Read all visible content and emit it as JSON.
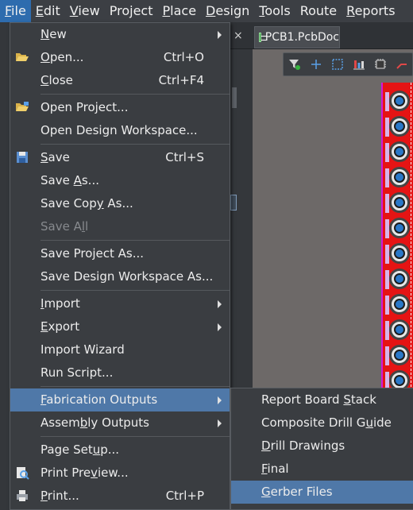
{
  "menubar": [
    {
      "label": "File",
      "ul": "F",
      "rest": "ile"
    },
    {
      "label": "Edit",
      "ul": "E",
      "rest": "dit"
    },
    {
      "label": "View",
      "ul": "V",
      "rest": "iew"
    },
    {
      "label": "Project",
      "ul": "",
      "rest": "Project"
    },
    {
      "label": "Place",
      "ul": "P",
      "rest": "lace"
    },
    {
      "label": "Design",
      "ul": "D",
      "rest": "esign"
    },
    {
      "label": "Tools",
      "ul": "T",
      "rest": "ools"
    },
    {
      "label": "Route",
      "ul": "",
      "rest": "Route"
    },
    {
      "label": "Reports",
      "ul": "R",
      "rest": "eports"
    }
  ],
  "document_tab": {
    "title": "PCB1.PcbDoc",
    "close": "×"
  },
  "file_menu": {
    "items": [
      {
        "pre": "",
        "ul": "N",
        "post": "ew",
        "shortcut": "",
        "submenu": true
      },
      {
        "pre": "",
        "ul": "O",
        "post": "pen...",
        "shortcut": "Ctrl+O",
        "icon": "folder-open-icon"
      },
      {
        "pre": "",
        "ul": "C",
        "post": "lose",
        "shortcut": "Ctrl+F4"
      },
      {
        "pre": "Open Project...",
        "ul": "",
        "post": "",
        "shortcut": "",
        "icon": "folder-project-icon"
      },
      {
        "pre": "Open Design Workspace...",
        "ul": "",
        "post": "",
        "shortcut": ""
      },
      {
        "pre": "",
        "ul": "S",
        "post": "ave",
        "shortcut": "Ctrl+S",
        "icon": "save-icon"
      },
      {
        "pre": "Save ",
        "ul": "A",
        "post": "s...",
        "shortcut": ""
      },
      {
        "pre": "Save Cop",
        "ul": "y",
        "post": " As...",
        "shortcut": ""
      },
      {
        "pre": "Save A",
        "ul": "l",
        "post": "l",
        "shortcut": "",
        "disabled": true
      },
      {
        "pre": "Save Project As...",
        "ul": "",
        "post": "",
        "shortcut": ""
      },
      {
        "pre": "Save Design Workspace As...",
        "ul": "",
        "post": "",
        "shortcut": ""
      },
      {
        "pre": "",
        "ul": "I",
        "post": "mport",
        "shortcut": "",
        "submenu": true
      },
      {
        "pre": "",
        "ul": "E",
        "post": "xport",
        "shortcut": "",
        "submenu": true
      },
      {
        "pre": "Import Wizard",
        "ul": "",
        "post": "",
        "shortcut": ""
      },
      {
        "pre": "Run Script...",
        "ul": "",
        "post": "",
        "shortcut": ""
      },
      {
        "pre": "",
        "ul": "F",
        "post": "abrication Outputs",
        "shortcut": "",
        "submenu": true,
        "highlighted": true
      },
      {
        "pre": "Assem",
        "ul": "b",
        "post": "ly Outputs",
        "shortcut": "",
        "submenu": true
      },
      {
        "pre": "Page Set",
        "ul": "u",
        "post": "p...",
        "shortcut": ""
      },
      {
        "pre": "Print Pre",
        "ul": "v",
        "post": "iew...",
        "shortcut": "",
        "icon": "print-preview-icon"
      },
      {
        "pre": "",
        "ul": "P",
        "post": "rint...",
        "shortcut": "Ctrl+P",
        "icon": "printer-icon"
      }
    ]
  },
  "fabrication_submenu": {
    "items": [
      {
        "pre": "Report Board ",
        "ul": "S",
        "post": "tack"
      },
      {
        "pre": "Composite Drill G",
        "ul": "u",
        "post": "ide"
      },
      {
        "pre": "",
        "ul": "D",
        "post": "rill Drawings"
      },
      {
        "pre": "",
        "ul": "F",
        "post": "inal"
      },
      {
        "pre": "",
        "ul": "G",
        "post": "erber Files",
        "highlighted": true
      }
    ]
  },
  "colors": {
    "menu_bg": "#3a3d41",
    "highlight": "#4f78a8",
    "board": "#e51414",
    "menubar_active": "#2e6cae"
  }
}
